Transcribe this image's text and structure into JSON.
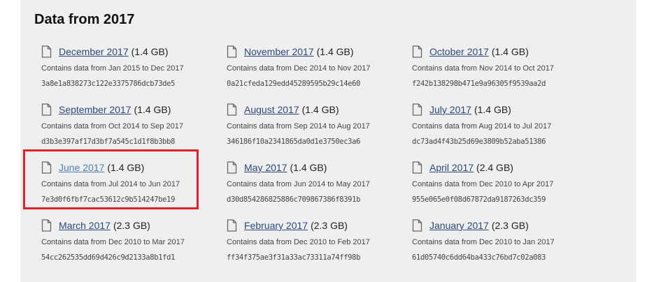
{
  "section": {
    "title": "Data from 2017"
  },
  "icons": {
    "file": "file-icon"
  },
  "colors": {
    "link": "#2b4a7a",
    "highlight_border": "#e0232a",
    "panel_background": "#efefef"
  },
  "items": [
    {
      "name": "December 2017",
      "size": "(1.4 GB)",
      "desc": "Contains data from Jan 2015 to Dec 2017",
      "hash": "3a8e1a838273c122e3375786dcb73de5"
    },
    {
      "name": "November 2017",
      "size": "(1.4 GB)",
      "desc": "Contains data from Dec 2014 to Nov 2017",
      "hash": "0a21cfeda129edd45289595b29c14e60"
    },
    {
      "name": "October 2017",
      "size": "(1.4 GB)",
      "desc": "Contains data from Nov 2014 to Oct 2017",
      "hash": "f242b138298b471e9a96305f9539aa2d"
    },
    {
      "name": "September 2017",
      "size": "(1.4 GB)",
      "desc": "Contains data from Oct 2014 to Sep 2017",
      "hash": "d3b3e397af17d3bf7a545c1d1f8b3bb8"
    },
    {
      "name": "August 2017",
      "size": "(1.4 GB)",
      "desc": "Contains data from Sep 2014 to Aug 2017",
      "hash": "346186f10a2341865da0d1e3750ec3a6"
    },
    {
      "name": "July 2017",
      "size": "(1.4 GB)",
      "desc": "Contains data from Aug 2014 to Jul 2017",
      "hash": "dc73ad4f43b25d69e3809b52aba51386"
    },
    {
      "name": "June 2017",
      "size": "(1.4 GB)",
      "desc": "Contains data from Jul 2014 to Jun 2017",
      "hash": "7e3d0f6fbf7cac53612c9b514247be19"
    },
    {
      "name": "May 2017",
      "size": "(1.4 GB)",
      "desc": "Contains data from Jun 2014 to May 2017",
      "hash": "d30d854286825886c709867386f8391b"
    },
    {
      "name": "April 2017",
      "size": "(2.4 GB)",
      "desc": "Contains data from Dec 2010 to Apr 2017",
      "hash": "955e065e0f08d67872da9187263dc359"
    },
    {
      "name": "March 2017",
      "size": "(2.3 GB)",
      "desc": "Contains data from Dec 2010 to Mar 2017",
      "hash": "54cc262535dd69d426c9d2133a8b1fd1"
    },
    {
      "name": "February 2017",
      "size": "(2.3 GB)",
      "desc": "Contains data from Dec 2010 to Feb 2017",
      "hash": "ff34f375ae3f31a33ac73311a74ff98b"
    },
    {
      "name": "January 2017",
      "size": "(2.3 GB)",
      "desc": "Contains data from Dec 2010 to Jan 2017",
      "hash": "61d05740c6dd64ba433c76bd7c02a083"
    }
  ]
}
